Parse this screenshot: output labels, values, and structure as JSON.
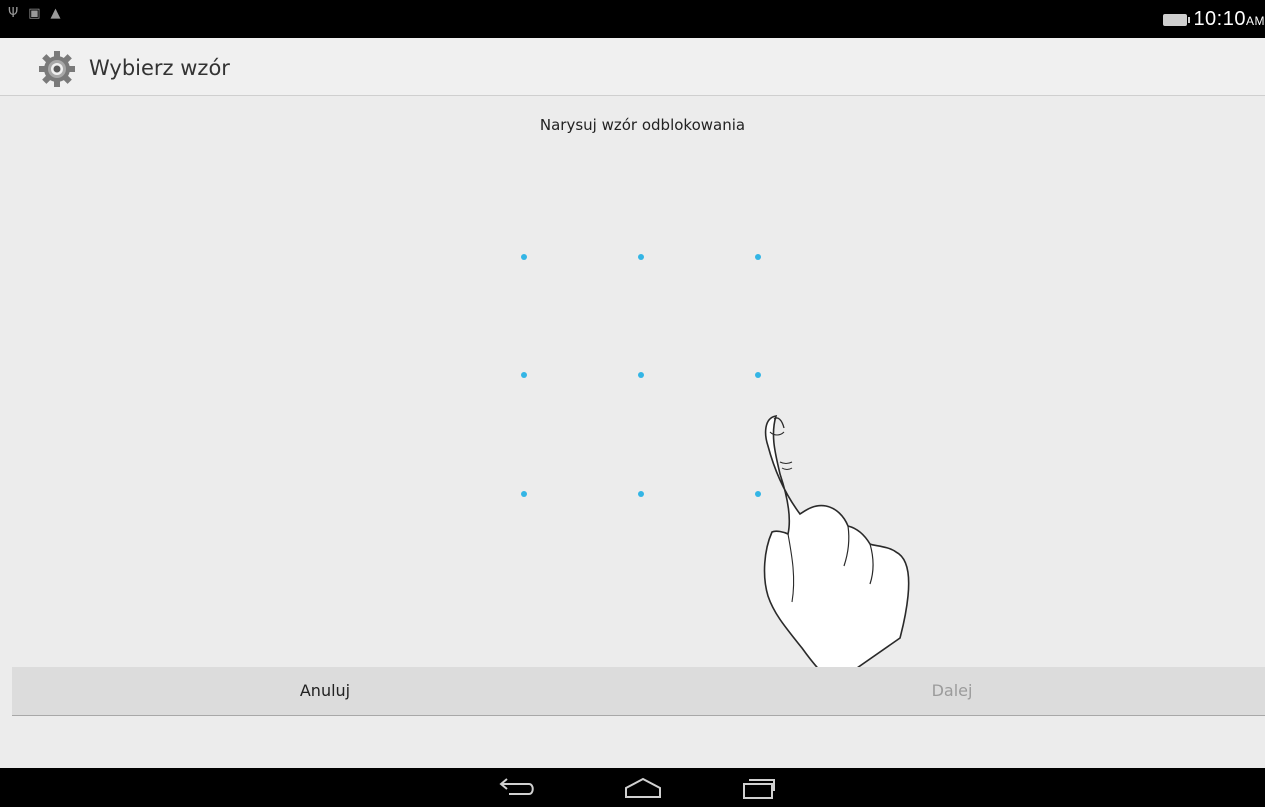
{
  "status_bar": {
    "left_icons": [
      "usb-icon",
      "image-icon",
      "warning-icon"
    ],
    "time": "10:10",
    "ampm": "AM",
    "battery_color": "#cfcfcf"
  },
  "action_bar": {
    "icon": "settings-gear-icon",
    "title": "Wybierz wzór"
  },
  "header": {
    "text": "Narysuj wzór odblokowania"
  },
  "pattern": {
    "rows": 3,
    "cols": 3,
    "dot_color": "#33b5e5"
  },
  "buttons": {
    "cancel_label": "Anuluj",
    "next_label": "Dalej"
  },
  "navigation": {
    "icons": [
      "back-icon",
      "home-icon",
      "recent-apps-icon"
    ]
  },
  "colors": {
    "background": "#ececec",
    "status_bar": "#000000",
    "accent": "#33b5e5"
  }
}
